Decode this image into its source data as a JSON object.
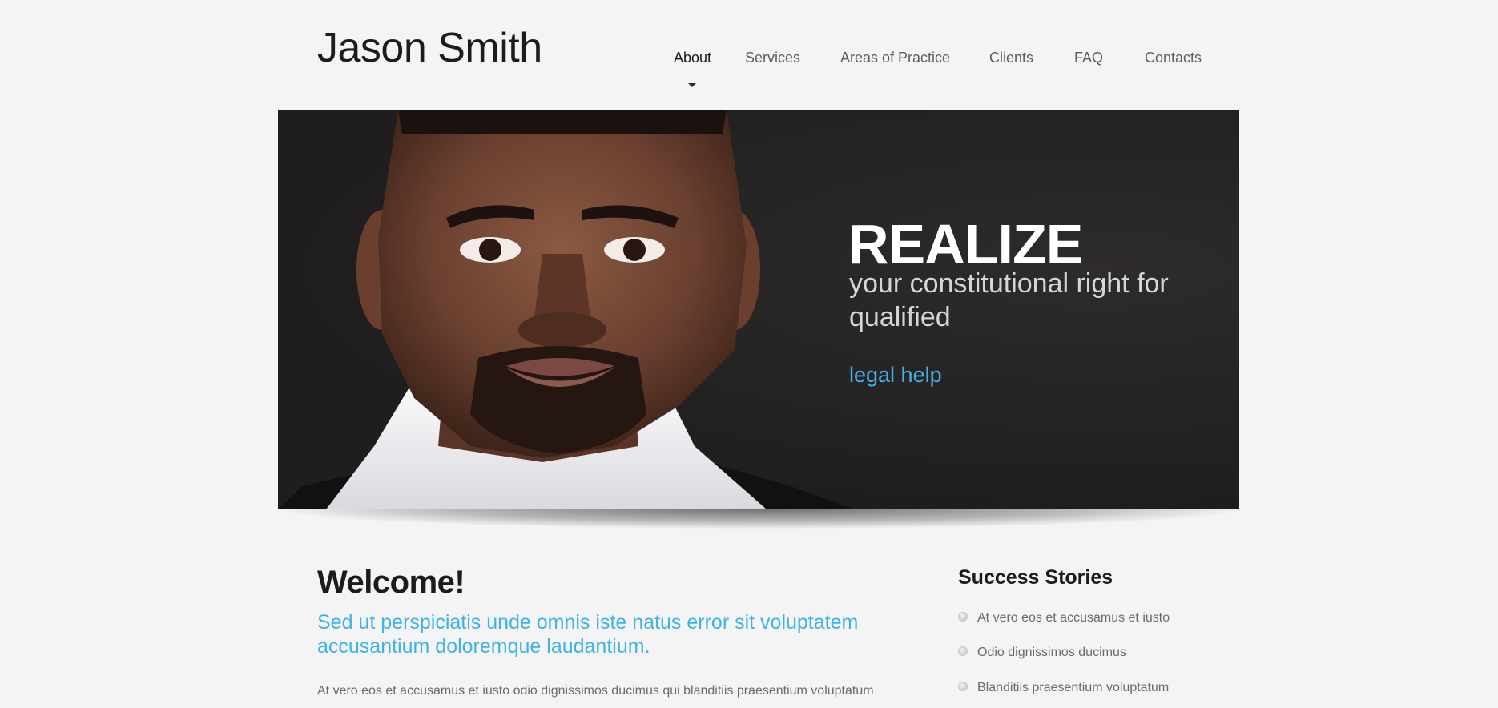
{
  "header": {
    "logo": "Jason Smith"
  },
  "nav": {
    "items": [
      {
        "label": "About",
        "active": true
      },
      {
        "label": "Services"
      },
      {
        "label": "Areas of Practice"
      },
      {
        "label": "Clients"
      },
      {
        "label": "FAQ"
      },
      {
        "label": "Contacts"
      }
    ]
  },
  "banner": {
    "headline": "REALIZE",
    "subline": "your constitutional right for qualified",
    "link": "legal help"
  },
  "welcome": {
    "title": "Welcome!",
    "lead": "Sed ut perspiciatis unde omnis iste natus error sit voluptatem accusantium doloremque laudantium.",
    "body": "At vero eos et accusamus et iusto odio dignissimos ducimus qui blanditiis praesentium voluptatum"
  },
  "sidebar": {
    "title": "Success Stories",
    "stories": [
      "At vero eos et accusamus et iusto",
      "Odio dignissimos ducimus",
      "Blanditiis praesentium voluptatum"
    ]
  },
  "colors": {
    "accent": "#3fb3e6",
    "page_background": "#f4f4f4",
    "banner_background": "#242222"
  }
}
